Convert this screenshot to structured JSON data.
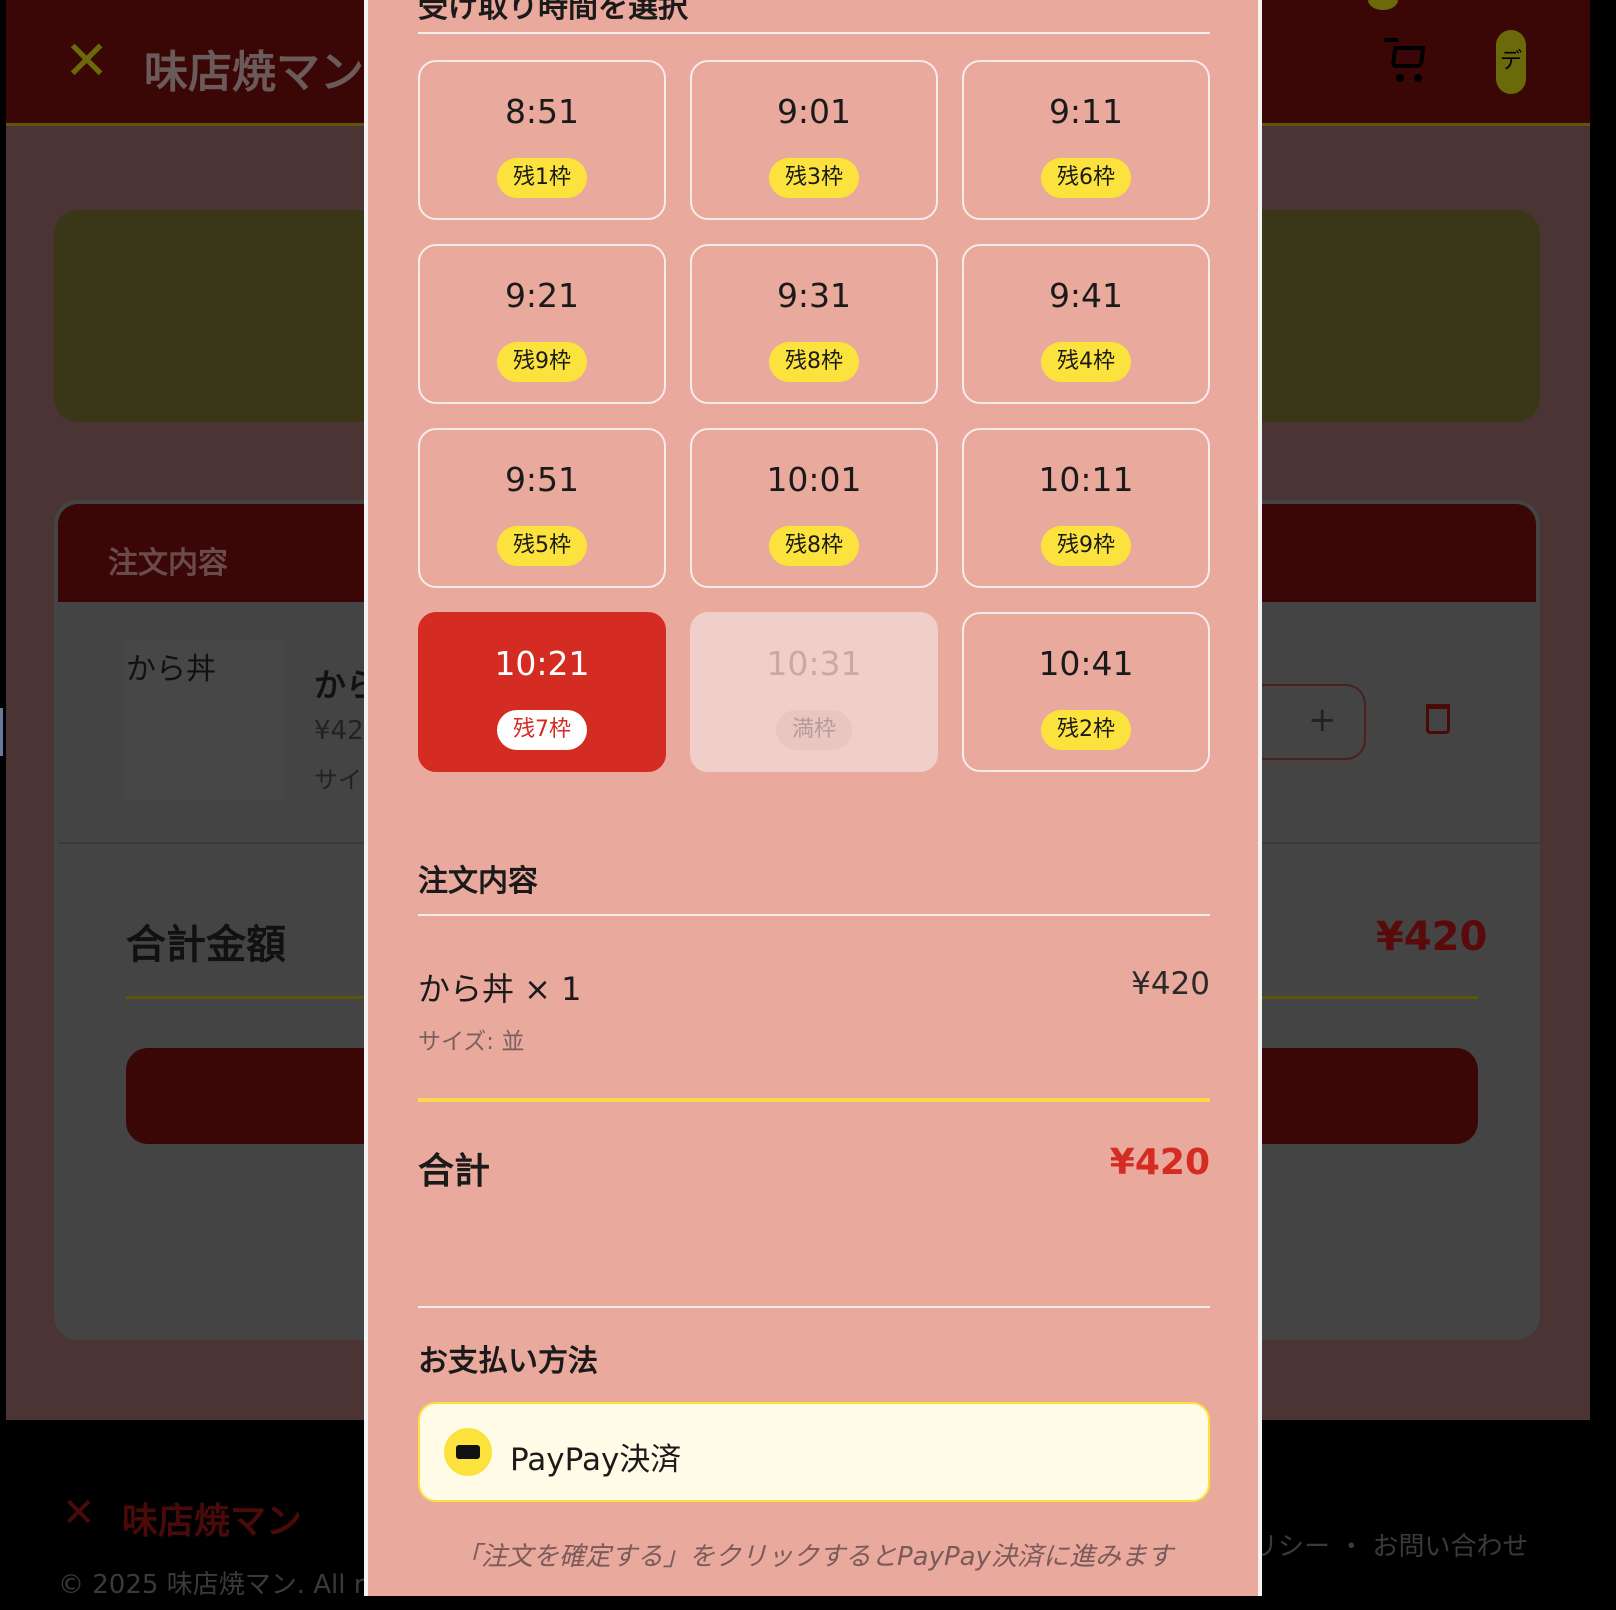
{
  "background": {
    "brand": "味店焼マン",
    "user_initial": "デ",
    "order_card_title": "注文内容",
    "item": {
      "image_alt": "から丼",
      "name": "から",
      "price": "¥42",
      "size": "サイ",
      "plus": "+"
    },
    "total_label": "合計金額",
    "total_value": "¥420",
    "footer": {
      "brand": "味店焼マン",
      "links": "リシー ・ お問い合わせ",
      "copyright": "© 2025 味店焼マン. All r"
    }
  },
  "modal": {
    "pickup_title": "受け取り時間を選択",
    "slots": [
      {
        "time": "8:51",
        "badge": "残1枠",
        "state": "available"
      },
      {
        "time": "9:01",
        "badge": "残3枠",
        "state": "available"
      },
      {
        "time": "9:11",
        "badge": "残6枠",
        "state": "available"
      },
      {
        "time": "9:21",
        "badge": "残9枠",
        "state": "available"
      },
      {
        "time": "9:31",
        "badge": "残8枠",
        "state": "available"
      },
      {
        "time": "9:41",
        "badge": "残4枠",
        "state": "available"
      },
      {
        "time": "9:51",
        "badge": "残5枠",
        "state": "available"
      },
      {
        "time": "10:01",
        "badge": "残8枠",
        "state": "available"
      },
      {
        "time": "10:11",
        "badge": "残9枠",
        "state": "available"
      },
      {
        "time": "10:21",
        "badge": "残7枠",
        "state": "selected"
      },
      {
        "time": "10:31",
        "badge": "満枠",
        "state": "full"
      },
      {
        "time": "10:41",
        "badge": "残2枠",
        "state": "available"
      }
    ],
    "order_title": "注文内容",
    "order_item": {
      "name": "から丼 × 1",
      "price": "¥420",
      "size": "サイズ: 並"
    },
    "total_label": "合計",
    "total_value": "¥420",
    "payment_title": "お支払い方法",
    "payment_option": "PayPay決済",
    "payment_note": "「注文を確定する」をクリックするとPayPay決済に進みます",
    "colors": {
      "accent": "#d42b22",
      "badge": "#fbe23c",
      "modal_bg": "#eaa99d"
    }
  }
}
